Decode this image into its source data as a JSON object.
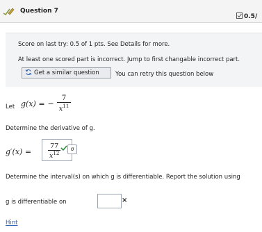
{
  "header": {
    "title": "Question 7",
    "score": "0.5/"
  },
  "banner": {
    "score_text": "Score on last try: 0.5 of 1 pts. See Details for more.",
    "incorrect_text": "At least one scored part is incorrect. Jump to first changable incorrect part.",
    "similar_button_label": "Get a similar question",
    "retry_text": "You can retry this question below"
  },
  "problem": {
    "let_label": "Let",
    "function_lhs": "g(x) =",
    "minus_sign": "−",
    "numerator": "7",
    "denominator_base": "x",
    "denominator_exp": "11",
    "instruction1": "Determine the derivative of g.",
    "derivative_lhs": "g′(x) =",
    "answer_numerator": "77",
    "answer_denominator_base": "x",
    "answer_denominator_exp": "12",
    "instruction2": "Determine the interval(s) on which g is differentiable. Report the solution using",
    "differentiable_label": "g is differentiable on",
    "differentiable_value": "",
    "hint_label": "Hint"
  },
  "icons": {
    "pencil": "pencil-check-icon",
    "score": "check-box-icon",
    "refresh": "refresh-icon",
    "correct": "check-icon",
    "sigma": "σ",
    "incorrect": "×"
  },
  "colors": {
    "correct_green": "#2e8b3d",
    "link_blue": "#2a5db0",
    "pencil_olive": "#8a9a3a"
  }
}
